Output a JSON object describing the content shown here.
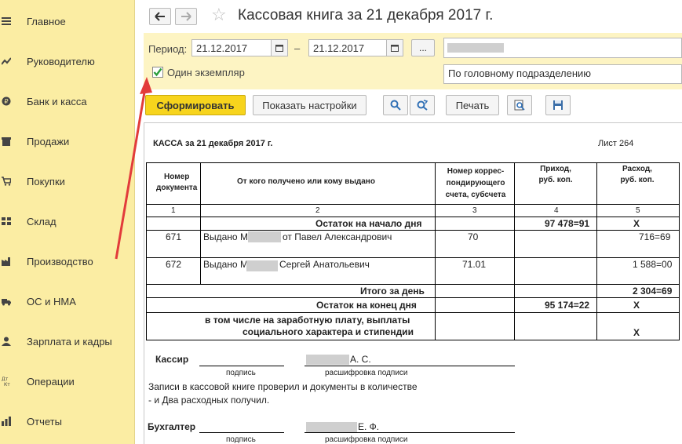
{
  "sidebar": {
    "items": [
      {
        "label": "Главное",
        "icon": "menu-icon"
      },
      {
        "label": "Руководителю",
        "icon": "chart-line-icon"
      },
      {
        "label": "Банк и касса",
        "icon": "ruble-icon"
      },
      {
        "label": "Продажи",
        "icon": "shop-icon"
      },
      {
        "label": "Покупки",
        "icon": "cart-icon"
      },
      {
        "label": "Склад",
        "icon": "warehouse-icon"
      },
      {
        "label": "Производство",
        "icon": "factory-icon"
      },
      {
        "label": "ОС и НМА",
        "icon": "truck-icon"
      },
      {
        "label": "Зарплата и кадры",
        "icon": "person-icon"
      },
      {
        "label": "Операции",
        "icon": "dt-kt-icon"
      },
      {
        "label": "Отчеты",
        "icon": "reports-icon"
      }
    ]
  },
  "header": {
    "title": "Кассовая книга за 21 декабря 2017 г."
  },
  "params": {
    "period_label": "Период:",
    "date_from": "21.12.2017",
    "dash": "–",
    "date_to": "21.12.2017",
    "dots_label": "...",
    "single_copy_label": "Один экземпляр",
    "single_copy_checked": true,
    "division": "По головному подразделению"
  },
  "toolbar": {
    "generate": "Сформировать",
    "show_settings": "Показать настройки",
    "print": "Печать"
  },
  "report": {
    "heading": "КАССА за 21 декабря 2017 г.",
    "sheet": "Лист 264",
    "columns": {
      "c1": [
        "Номер",
        "документа"
      ],
      "c2": "От кого получено или кому выдано",
      "c3": [
        "Номер коррес-",
        "пондирующего",
        "счета, субсчета"
      ],
      "c4": [
        "Приход,",
        "руб. коп."
      ],
      "c5": [
        "Расход,",
        "руб. коп."
      ]
    },
    "col_numbers": [
      "1",
      "2",
      "3",
      "4",
      "5"
    ],
    "opening_label": "Остаток на начало дня",
    "opening_income": "97 478=91",
    "opening_expense": "X",
    "rows": [
      {
        "doc": "671",
        "who_prefix": "Выдано М",
        "who_suffix": "от Павел Александрович",
        "account": "70",
        "income": "",
        "expense": "716=69"
      },
      {
        "doc": "672",
        "who_prefix": "Выдано М",
        "who_suffix": "Сергей Анатольевич",
        "account": "71.01",
        "income": "",
        "expense": "1 588=00"
      }
    ],
    "day_total_label": "Итого за день",
    "day_total_expense": "2 304=69",
    "closing_label": "Остаток на конец  дня",
    "closing_income": "95 174=22",
    "closing_expense": "X",
    "including_line1": "в том числе на заработную плату, выплаты",
    "including_line2": "социального характера и стипендии",
    "including_expense": "X",
    "cashier_label": "Кассир",
    "cashier_name": "А. С.",
    "signature_caption": "подпись",
    "decoding_caption": "расшифровка подписи",
    "checked_line1": "Записи в кассовой книге проверил и документы в количестве",
    "checked_line2": " -  и Два расходных получил.",
    "accountant_label": "Бухгалтер",
    "accountant_name": "Е. Ф."
  },
  "colors": {
    "sidebar_bg": "#fbeda3",
    "params_bg": "#fdf4c3",
    "primary_btn": "#f7d41d",
    "arrow": "#e23b3b",
    "check": "#2a9d3a"
  }
}
